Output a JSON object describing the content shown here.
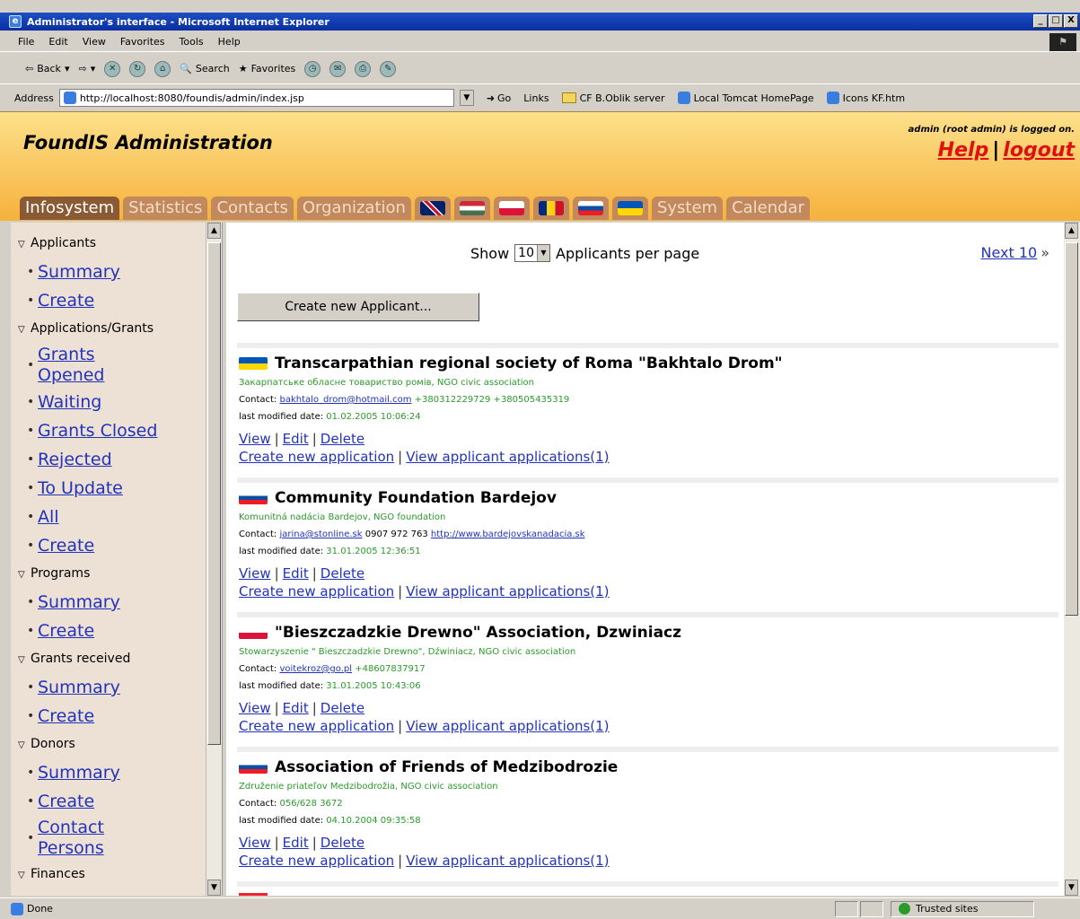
{
  "browser": {
    "window_title": "Administrator's interface - Microsoft Internet Explorer",
    "window_buttons": [
      "_",
      "□",
      "X"
    ],
    "menu": [
      "File",
      "Edit",
      "View",
      "Favorites",
      "Tools",
      "Help"
    ],
    "toolbar": {
      "back": "Back",
      "search": "Search",
      "favorites": "Favorites"
    },
    "address_label": "Address",
    "address_value": "http://localhost:8080/foundis/admin/index.jsp",
    "go_label": "Go",
    "links_label": "Links",
    "links": [
      "CF B.Oblik server",
      "Local Tomcat HomePage",
      "Icons KF.htm"
    ]
  },
  "app": {
    "title": "FoundIS Administration",
    "logged_in": "admin (root admin) is logged on.",
    "help": "Help",
    "logout": "logout",
    "tabs": [
      "Infosystem",
      "Statistics",
      "Contacts",
      "Organization",
      "System",
      "Calendar"
    ],
    "flags": [
      "uk",
      "hu",
      "pl",
      "ro",
      "sk",
      "ua"
    ]
  },
  "sidebar": {
    "sections": [
      {
        "label": "Applicants",
        "items": [
          "Summary",
          "Create"
        ]
      },
      {
        "label": "Applications/Grants",
        "items": [
          "Grants Opened",
          "Waiting",
          "Grants Closed",
          "Rejected",
          "To Update",
          "All",
          "Create"
        ]
      },
      {
        "label": "Programs",
        "items": [
          "Summary",
          "Create"
        ]
      },
      {
        "label": "Grants received",
        "items": [
          "Summary",
          "Create"
        ]
      },
      {
        "label": "Donors",
        "items": [
          "Summary",
          "Create",
          "Contact Persons"
        ]
      },
      {
        "label": "Finances",
        "items": []
      }
    ]
  },
  "main": {
    "show_label": "Show",
    "per_page": "10",
    "per_page_suffix": "Applicants per page",
    "next": "Next 10",
    "next_arrow": "»",
    "create_button": "Create new Applicant...",
    "contact_label": "Contact:",
    "date_label": "last modified date:",
    "view": "View",
    "edit": "Edit",
    "delete": "Delete",
    "create_application": "Create new application",
    "view_applications": "View applicant applications(1)",
    "applicants": [
      {
        "flag": "ua",
        "name": "Transcarpathian regional society of Roma \"Bakhtalo Drom\"",
        "sub": "Закарпатське обласне товариство ромів, NGO civic association",
        "email": "bakhtalo_drom@hotmail.com",
        "phone": "+380312229729 +380505435319",
        "web": "",
        "date": "01.02.2005 10:06:24"
      },
      {
        "flag": "sk",
        "name": "Community Foundation Bardejov",
        "sub": "Komunitná nadácia Bardejov, NGO foundation",
        "email": "jarina@stonline.sk",
        "phone": "0907 972 763",
        "web": "http://www.bardejovskanadacia.sk",
        "date": "31.01.2005 12:36:51"
      },
      {
        "flag": "pl",
        "name": "\"Bieszczadzkie Drewno\" Association, Dzwiniacz",
        "sub": "Stowarzyszenie \" Bieszczadzkie Drewno\", Dźwiniacz, NGO civic association",
        "email": "voitekroz@go.pl",
        "phone": "+48607837917",
        "web": "",
        "date": "31.01.2005 10:43:06"
      },
      {
        "flag": "sk",
        "name": "Association of Friends of Medzibodrozie",
        "sub": "Združenie priateľov Medzibodrožia, NGO civic association",
        "email": "",
        "phone": "056/628 3672",
        "web": "",
        "date": "04.10.2004 09:35:58"
      }
    ]
  },
  "status": {
    "left": "Done",
    "zone": "Trusted sites"
  }
}
